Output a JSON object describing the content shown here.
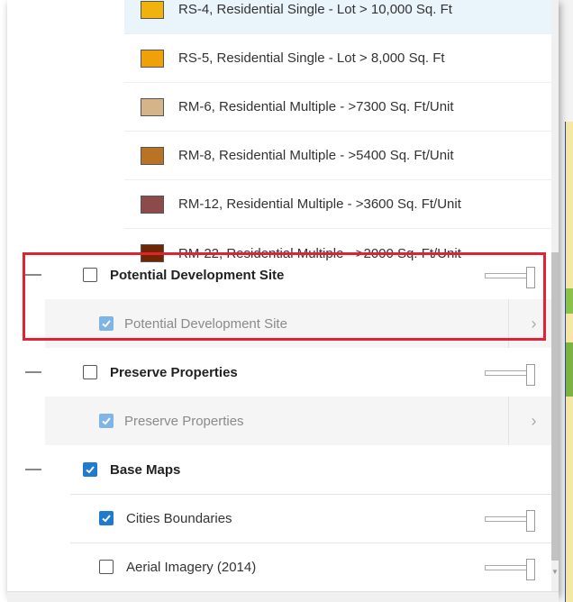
{
  "legend": [
    {
      "label": "RS-4, Residential Single - Lot > 10,000 Sq. Ft",
      "color": "#f2b20e",
      "highlighted": true
    },
    {
      "label": "RS-5, Residential Single - Lot > 8,000 Sq. Ft",
      "color": "#f0a008",
      "highlighted": false
    },
    {
      "label": "RM-6, Residential Multiple - >7300 Sq. Ft/Unit",
      "color": "#d6b48a",
      "highlighted": false
    },
    {
      "label": "RM-8, Residential Multiple - >5400 Sq. Ft/Unit",
      "color": "#b87424",
      "highlighted": false
    },
    {
      "label": "RM-12, Residential Multiple - >3600 Sq. Ft/Unit",
      "color": "#8c4a4a",
      "highlighted": false
    },
    {
      "label": "RM-22, Residential Multiple - >2000 Sq. Ft/Unit",
      "color": "#6e2604",
      "highlighted": false
    }
  ],
  "layers": {
    "potential_group": {
      "label": "Potential Development Site",
      "checked": false
    },
    "potential_sub": {
      "label": "Potential Development Site",
      "checked": true
    },
    "preserve_group": {
      "label": "Preserve Properties",
      "checked": false
    },
    "preserve_sub": {
      "label": "Preserve Properties",
      "checked": true
    },
    "base_group": {
      "label": "Base Maps",
      "checked": true
    },
    "cities": {
      "label": "Cities Boundaries",
      "checked": true
    },
    "aerial": {
      "label": "Aerial Imagery (2014)",
      "checked": false
    }
  },
  "icons": {
    "expand": "chevron-right-icon",
    "collapse": "minus-icon",
    "opacity": "opacity-slider"
  },
  "colors": {
    "accent": "#1f7ad0",
    "highlight_box": "#e02231"
  }
}
